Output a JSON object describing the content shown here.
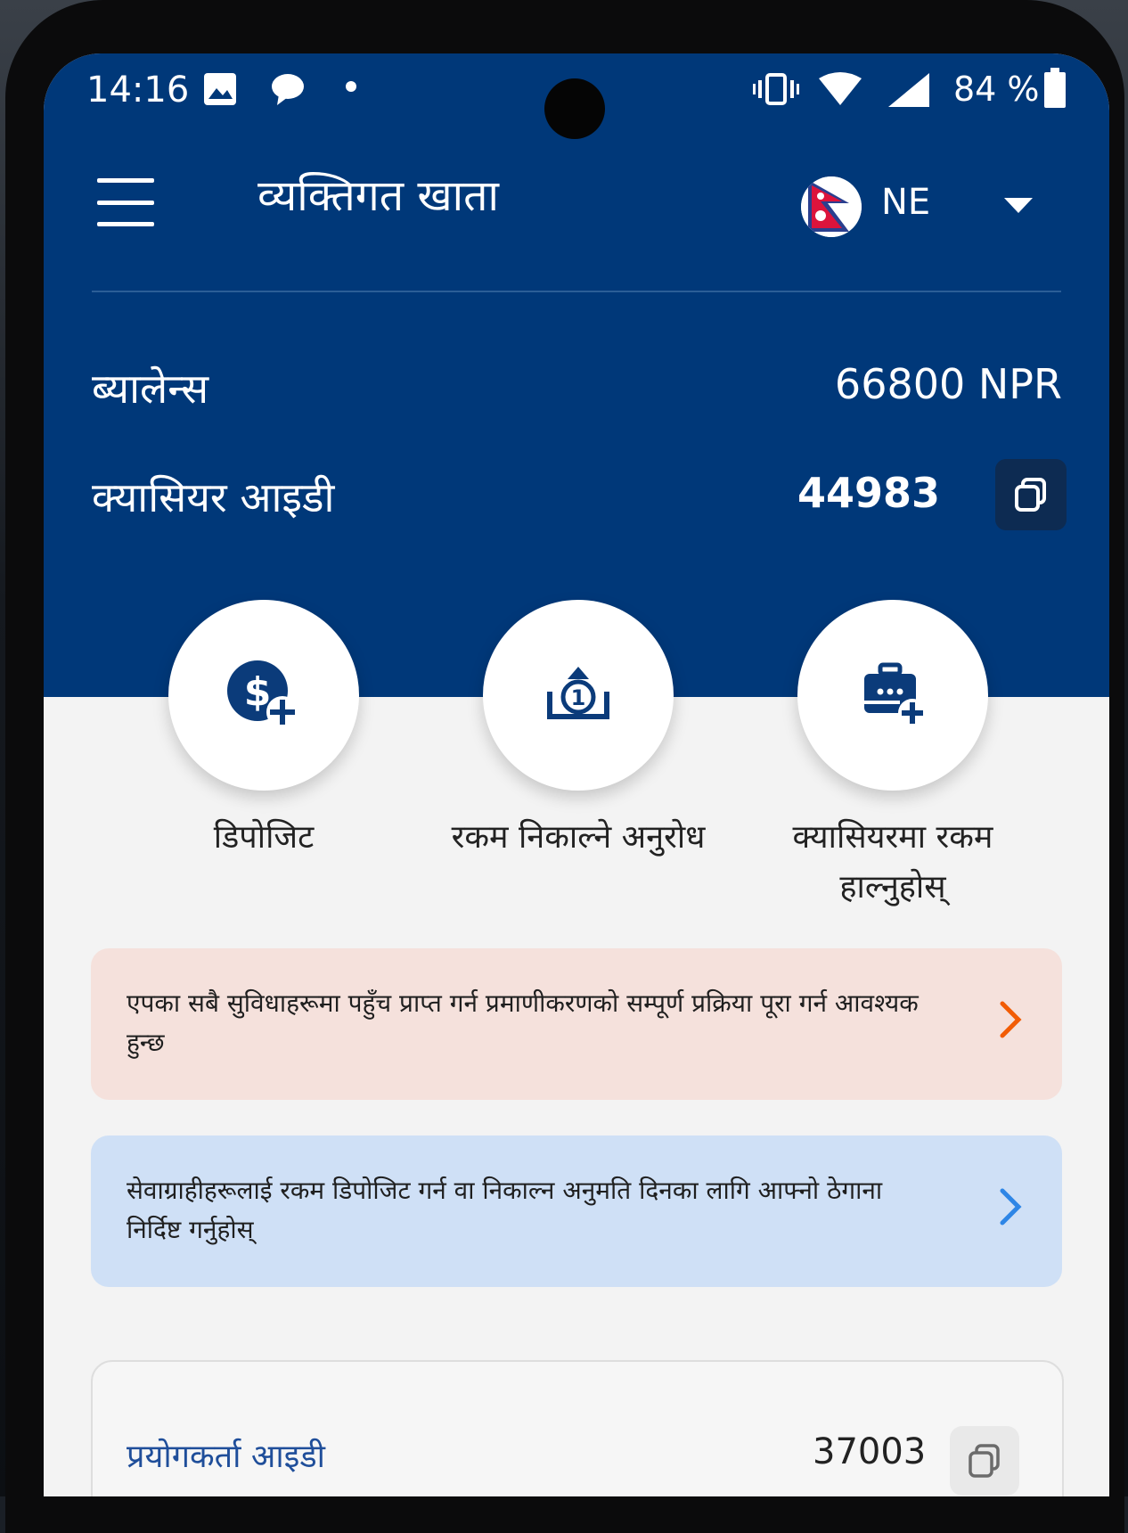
{
  "status_bar": {
    "time": "14:16",
    "battery": "84 %"
  },
  "app_bar": {
    "title": "व्यक्तिगत खाता",
    "language": "NE"
  },
  "account": {
    "balance_label": "ब्यालेन्स",
    "balance_value": "66800 NPR",
    "cashier_id_label": "क्यासियर आइडी",
    "cashier_id_value": "44983"
  },
  "actions": [
    {
      "label": "डिपोजिट",
      "icon": "dollar-plus-icon"
    },
    {
      "label": "रकम निकाल्ने अनुरोध",
      "icon": "withdraw-request-icon"
    },
    {
      "label_line1": "क्यासियरमा रकम",
      "label_line2": "हाल्नुहोस्",
      "icon": "cashier-transfer-icon"
    }
  ],
  "banners": [
    {
      "text": "एपका सबै सुविधाहरूमा पहुँच प्राप्त गर्न प्रमाणीकरणको सम्पूर्ण प्रक्रिया पूरा गर्न आवश्यक हुन्छ",
      "background": "#f5e1dc",
      "chevron_color": "#f25c05"
    },
    {
      "text": "सेवाग्राहीहरूलाई रकम डिपोजिट गर्न वा निकाल्न अनुमति दिनका लागि आफ्नो ठेगाना निर्दिष्ट गर्नुहोस्",
      "background": "#cfe0f6",
      "chevron_color": "#2e86e6"
    }
  ],
  "user_card": {
    "label": "प्रयोगकर्ता आइडी",
    "value": "37003"
  },
  "colors": {
    "header": "#003879",
    "background": "#f3f3f3",
    "icon": "#0b3b7a"
  }
}
